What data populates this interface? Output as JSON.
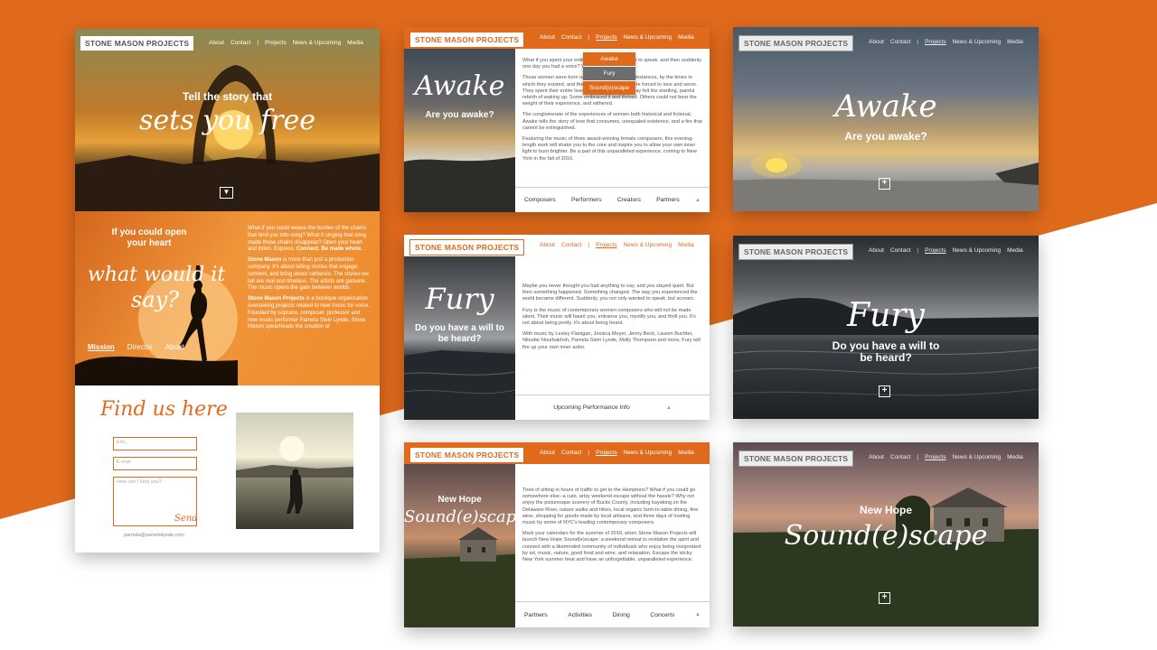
{
  "colors": {
    "accent": "#e06a1c",
    "accent_dark": "#c85a12"
  },
  "brand": "STONE MASON PROJECTS",
  "nav": {
    "about": "About",
    "contact": "Contact",
    "sep": "|",
    "projects": "Projects",
    "news": "News & Upcoming",
    "media": "Media"
  },
  "home": {
    "hero_line1": "Tell the story that",
    "hero_line2": "sets you free",
    "mission_q1": "If you could open",
    "mission_q2": "your heart",
    "mission_q3": "what would it",
    "mission_q4": "say?",
    "tabs": [
      "Mission",
      "Director",
      "About"
    ],
    "intro": "What if you could weave the burden of the chains that bind you into song? What if singing that song made those chains disappear? Open your heart and listen. Express.",
    "intro_bold": "Connect. Be made whole.",
    "para2_bold": "Stone Mason",
    "para2": " is more than just a production company. It's about telling stories that engage, connect, and bring about catharsis. The stories we tell are real and timeless. The artists are genuine. The music opens the gate between worlds.",
    "para3_bold": "Stone Mason Projects",
    "para3": " is a boutique organization overseeing projects related to new music for voice. Founded by soprano, composer, professor and new music performer Pamela Stein Lynde, Stone Mason spearheads the creation of",
    "find_us": "Find us here",
    "name_placeholder": "Eric_",
    "email_placeholder": "E-mail",
    "message_placeholder": "How can I help you?",
    "send": "Send",
    "email": "pamela@pamelalynde.com"
  },
  "awake": {
    "title": "Awake",
    "subtitle": "Are you awake?",
    "dropdown": [
      "Awake",
      "Fury",
      "Sound(e)scape"
    ],
    "p1": "What if you spent your entire life without being able to speak, and then suddenly one day you had a voice? What would you say?",
    "p2": "Those women were born under very different circumstances, by the times in which they existed, and the circumstances they were forced to love and serve. They spent their entire lives asleep and then one day felt the startling, painful rebirth of waking up. Some embraced it and thrived. Others could not bear the weight of their experience, and withered.",
    "p3": "The conglomerate of the experiences of women both historical and fictional, Awake tells the story of love that consumes, unequaled existence, and a fire that cannot be extinguished.",
    "p4": "Featuring the music of three award-winning female composers, this evening-length work will shake you to the core and inspire you to allow your own inner light to burn brighter. Be a part of this unparalleled experience, coming to New York in the fall of 2016.",
    "tabs": [
      "Composers",
      "Performers",
      "Creators",
      "Partners"
    ]
  },
  "fury": {
    "title": "Fury",
    "subtitle1": "Do you have a will to",
    "subtitle2": "be heard?",
    "p1": "Maybe you never thought you had anything to say, and you stayed quiet. But then something happened. Something changed. The way you experienced the world became different. Suddenly, you not only wanted to speak, but scream.",
    "p2": "Fury is the music of contemporary women composers who will not be made silent. Their music will haunt you, entrance you, mystify you, and thrill you. It's not about being pretty. It's about being heard.",
    "p3": "With music by Lesley Flanigan, Jessica Moyer, Jenny Beck, Lauren Buchter, Niloufar Nourbakhsh, Pamela Stein Lynde, Molly Thompson and more, Fury will fire up your own inner ardor.",
    "upcoming": "Upcoming Performance Info"
  },
  "sound": {
    "kicker": "New Hope",
    "title": "Sound(e)scape",
    "p1": "Tired of sitting in hours of traffic to get to the Hamptons? What if you could go somewhere else--a cute, artsy weekend escape without the hassle? Why not enjoy the picturesque scenery of Bucks County, including kayaking on the Delaware River, nature walks and hikes, local organic farm-to-table dining, fine wine, shopping for goods made by local artisans, and three days of riveting music by some of NYC's leading contemporary composers.",
    "p2": "Mark your calendars for the summer of 2016, when Stone Mason Projects will launch New Hope Sound(e)scape: a weekend retreat to revitalize the spirit and connect with a likeminded community of individuals who enjoy being invigorated by art, music, nature, good food and wine, and relaxation. Escape the sticky New York summer heat and have an unforgettable, unparalleled experience.",
    "tabs": [
      "Partners",
      "Activities",
      "Dining",
      "Concerts"
    ]
  }
}
